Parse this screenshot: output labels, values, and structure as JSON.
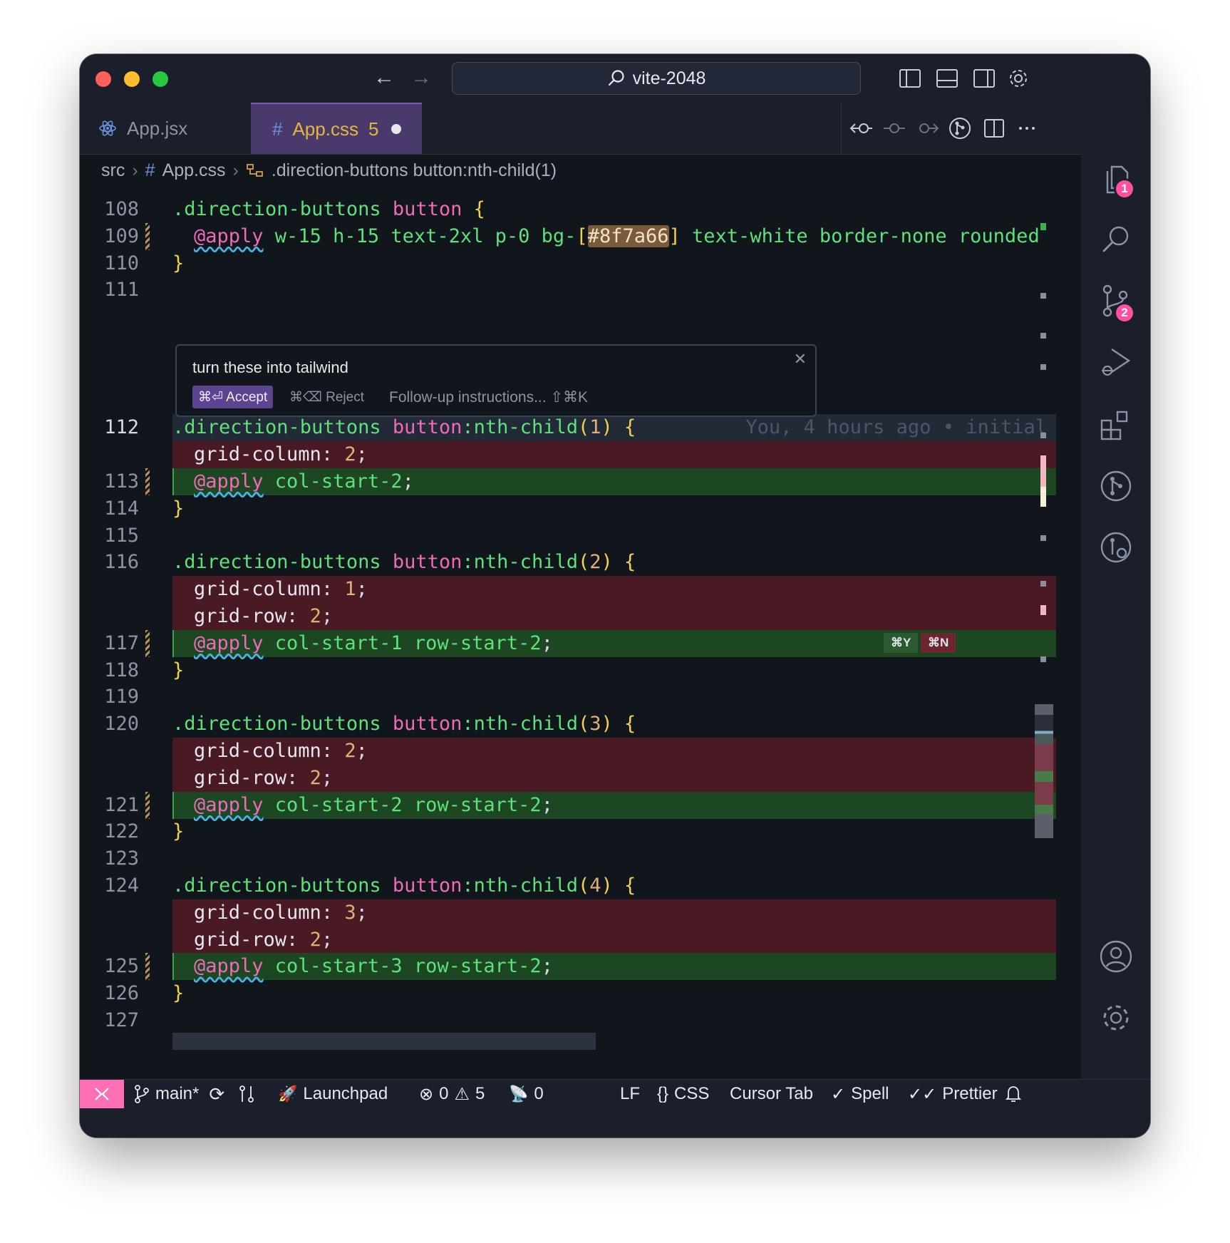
{
  "window": {
    "title": "vite-2048"
  },
  "tabs": [
    {
      "label": "App.jsx",
      "icon": "react-icon"
    },
    {
      "label": "App.css",
      "problems": "5",
      "icon": "hash-icon"
    }
  ],
  "breadcrumb": {
    "folder": "src",
    "file": "App.css",
    "symbol": ".direction-buttons button:nth-child(1)"
  },
  "activity_badges": {
    "explorer": "1",
    "source_control": "2"
  },
  "prompt": {
    "text": "turn these into tailwind",
    "accept": "⌘⏎ Accept",
    "reject": "⌘⌫ Reject",
    "followup": "Follow-up instructions... ⇧⌘K",
    "close": "✕"
  },
  "editor": {
    "lines": [
      {
        "num": "108",
        "kind": "normal",
        "indent": false,
        "tokens": [
          {
            "t": ".direction-buttons ",
            "c": "c-sel"
          },
          {
            "t": "button ",
            "c": "c-tag"
          },
          {
            "t": "{",
            "c": "c-brace"
          }
        ]
      },
      {
        "num": "109",
        "kind": "normal",
        "indent": true,
        "mark": true,
        "tokens": [
          {
            "t": "@apply",
            "c": "c-at"
          },
          {
            "t": " w-15 h-15 text-2xl p-0 bg-",
            "c": "c-util"
          },
          {
            "t": "[",
            "c": "c-brace"
          },
          {
            "t": "#8f7a66",
            "c": "c-hex"
          },
          {
            "t": "]",
            "c": "c-brace"
          },
          {
            "t": " text-white border-none rounded",
            "c": "c-util"
          }
        ]
      },
      {
        "num": "110",
        "kind": "normal",
        "indent": false,
        "tokens": [
          {
            "t": "}",
            "c": "c-brace"
          }
        ]
      },
      {
        "num": "111",
        "kind": "normal",
        "indent": false,
        "tokens": []
      },
      {
        "num": "112",
        "kind": "hl",
        "indent": false,
        "active": true,
        "tokens": [
          {
            "t": ".direction-buttons ",
            "c": "c-sel"
          },
          {
            "t": "button",
            "c": "c-tag"
          },
          {
            "t": ":nth-child",
            "c": "c-pse"
          },
          {
            "t": "(",
            "c": "c-brace"
          },
          {
            "t": "1",
            "c": "c-num"
          },
          {
            "t": ") {",
            "c": "c-brace"
          }
        ],
        "blame": "You, 4 hours ago • initial"
      },
      {
        "num": "",
        "kind": "del",
        "indent": true,
        "tokens": [
          {
            "t": "grid-column",
            "c": "c-prop"
          },
          {
            "t": ": ",
            "c": "c-punc"
          },
          {
            "t": "2",
            "c": "c-num"
          },
          {
            "t": ";",
            "c": "c-punc"
          }
        ]
      },
      {
        "num": "113",
        "kind": "add",
        "indent": true,
        "mark": true,
        "tokens": [
          {
            "t": "@apply",
            "c": "c-at"
          },
          {
            "t": " col-start-2",
            "c": "c-util"
          },
          {
            "t": ";",
            "c": "c-punc"
          }
        ]
      },
      {
        "num": "114",
        "kind": "normal",
        "indent": false,
        "tokens": [
          {
            "t": "}",
            "c": "c-brace"
          }
        ]
      },
      {
        "num": "115",
        "kind": "normal",
        "indent": false,
        "tokens": []
      },
      {
        "num": "116",
        "kind": "normal",
        "indent": false,
        "tokens": [
          {
            "t": ".direction-buttons ",
            "c": "c-sel"
          },
          {
            "t": "button",
            "c": "c-tag"
          },
          {
            "t": ":nth-child",
            "c": "c-pse"
          },
          {
            "t": "(",
            "c": "c-brace"
          },
          {
            "t": "2",
            "c": "c-num"
          },
          {
            "t": ") {",
            "c": "c-brace"
          }
        ]
      },
      {
        "num": "",
        "kind": "del",
        "indent": true,
        "tokens": [
          {
            "t": "grid-column",
            "c": "c-prop"
          },
          {
            "t": ": ",
            "c": "c-punc"
          },
          {
            "t": "1",
            "c": "c-num"
          },
          {
            "t": ";",
            "c": "c-punc"
          }
        ]
      },
      {
        "num": "",
        "kind": "del",
        "indent": true,
        "tokens": [
          {
            "t": "grid-row",
            "c": "c-prop"
          },
          {
            "t": ": ",
            "c": "c-punc"
          },
          {
            "t": "2",
            "c": "c-num"
          },
          {
            "t": ";",
            "c": "c-punc"
          }
        ]
      },
      {
        "num": "117",
        "kind": "add",
        "indent": true,
        "mark": true,
        "chips": true,
        "tokens": [
          {
            "t": "@apply",
            "c": "c-at"
          },
          {
            "t": " col-start-1 row-start-2",
            "c": "c-util"
          },
          {
            "t": ";",
            "c": "c-punc"
          }
        ]
      },
      {
        "num": "118",
        "kind": "normal",
        "indent": false,
        "tokens": [
          {
            "t": "}",
            "c": "c-brace"
          }
        ]
      },
      {
        "num": "119",
        "kind": "normal",
        "indent": false,
        "tokens": []
      },
      {
        "num": "120",
        "kind": "normal",
        "indent": false,
        "tokens": [
          {
            "t": ".direction-buttons ",
            "c": "c-sel"
          },
          {
            "t": "button",
            "c": "c-tag"
          },
          {
            "t": ":nth-child",
            "c": "c-pse"
          },
          {
            "t": "(",
            "c": "c-brace"
          },
          {
            "t": "3",
            "c": "c-num"
          },
          {
            "t": ") {",
            "c": "c-brace"
          }
        ]
      },
      {
        "num": "",
        "kind": "del",
        "indent": true,
        "tokens": [
          {
            "t": "grid-column",
            "c": "c-prop"
          },
          {
            "t": ": ",
            "c": "c-punc"
          },
          {
            "t": "2",
            "c": "c-num"
          },
          {
            "t": ";",
            "c": "c-punc"
          }
        ]
      },
      {
        "num": "",
        "kind": "del",
        "indent": true,
        "tokens": [
          {
            "t": "grid-row",
            "c": "c-prop"
          },
          {
            "t": ": ",
            "c": "c-punc"
          },
          {
            "t": "2",
            "c": "c-num"
          },
          {
            "t": ";",
            "c": "c-punc"
          }
        ]
      },
      {
        "num": "121",
        "kind": "add",
        "indent": true,
        "mark": true,
        "tokens": [
          {
            "t": "@apply",
            "c": "c-at"
          },
          {
            "t": " col-start-2 row-start-2",
            "c": "c-util"
          },
          {
            "t": ";",
            "c": "c-punc"
          }
        ]
      },
      {
        "num": "122",
        "kind": "normal",
        "indent": false,
        "tokens": [
          {
            "t": "}",
            "c": "c-brace"
          }
        ]
      },
      {
        "num": "123",
        "kind": "normal",
        "indent": false,
        "tokens": []
      },
      {
        "num": "124",
        "kind": "normal",
        "indent": false,
        "tokens": [
          {
            "t": ".direction-buttons ",
            "c": "c-sel"
          },
          {
            "t": "button",
            "c": "c-tag"
          },
          {
            "t": ":nth-child",
            "c": "c-pse"
          },
          {
            "t": "(",
            "c": "c-brace"
          },
          {
            "t": "4",
            "c": "c-num"
          },
          {
            "t": ") {",
            "c": "c-brace"
          }
        ]
      },
      {
        "num": "",
        "kind": "del",
        "indent": true,
        "tokens": [
          {
            "t": "grid-column",
            "c": "c-prop"
          },
          {
            "t": ": ",
            "c": "c-punc"
          },
          {
            "t": "3",
            "c": "c-num"
          },
          {
            "t": ";",
            "c": "c-punc"
          }
        ]
      },
      {
        "num": "",
        "kind": "del",
        "indent": true,
        "tokens": [
          {
            "t": "grid-row",
            "c": "c-prop"
          },
          {
            "t": ": ",
            "c": "c-punc"
          },
          {
            "t": "2",
            "c": "c-num"
          },
          {
            "t": ";",
            "c": "c-punc"
          }
        ]
      },
      {
        "num": "125",
        "kind": "add",
        "indent": true,
        "mark": true,
        "tokens": [
          {
            "t": "@apply",
            "c": "c-at"
          },
          {
            "t": " col-start-3 row-start-2",
            "c": "c-util"
          },
          {
            "t": ";",
            "c": "c-punc"
          }
        ]
      },
      {
        "num": "126",
        "kind": "normal",
        "indent": false,
        "tokens": [
          {
            "t": "}",
            "c": "c-brace"
          }
        ]
      },
      {
        "num": "127",
        "kind": "normal",
        "indent": false,
        "tokens": []
      }
    ],
    "chips": {
      "accept": "⌘Y",
      "reject": "⌘N"
    }
  },
  "statusbar": {
    "branch": "main*",
    "launchpad": "Launchpad",
    "errors": "0",
    "warnings": "5",
    "ports": "0",
    "eol": "LF",
    "language": "CSS",
    "cursor_tab": "Cursor Tab",
    "spell": "Spell",
    "prettier": "Prettier"
  },
  "colors": {
    "accent": "#ff6fb5",
    "added": "#1d4722",
    "removed": "#4a1a24",
    "tab_active": "#4a3a6b"
  }
}
